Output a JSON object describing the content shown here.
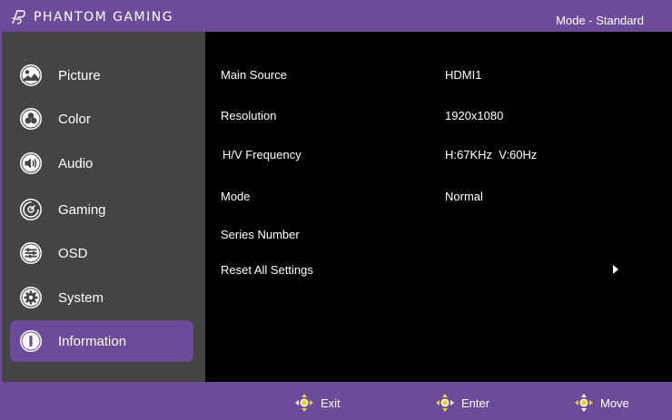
{
  "header": {
    "brand": "PHANTOM GAMING",
    "mode": "Mode - Standard"
  },
  "sidebar": {
    "items": [
      {
        "label": "Picture",
        "icon": "picture-icon",
        "active": false
      },
      {
        "label": "Color",
        "icon": "color-icon",
        "active": false
      },
      {
        "label": "Audio",
        "icon": "audio-icon",
        "active": false
      },
      {
        "label": "Gaming",
        "icon": "gaming-icon",
        "active": false
      },
      {
        "label": "OSD",
        "icon": "osd-icon",
        "active": false
      },
      {
        "label": "System",
        "icon": "system-icon",
        "active": false
      },
      {
        "label": "Information",
        "icon": "information-icon",
        "active": true
      }
    ]
  },
  "info": {
    "rows": [
      {
        "label": "Main Source",
        "value": "HDMI1"
      },
      {
        "label": "Resolution",
        "value": "1920x1080"
      },
      {
        "label": "H/V Frequency",
        "value": "H:67KHz  V:60Hz"
      },
      {
        "label": "Mode",
        "value": "Normal"
      },
      {
        "label": "Series Number",
        "value": ""
      },
      {
        "label": "Reset All Settings",
        "value": ""
      }
    ]
  },
  "footer": {
    "hints": [
      {
        "label": "Exit",
        "icon": "joystick-left-icon"
      },
      {
        "label": "Enter",
        "icon": "joystick-right-icon"
      },
      {
        "label": "Move",
        "icon": "joystick-updown-icon"
      }
    ]
  },
  "colors": {
    "accent": "#6c4b9b",
    "sidebar": "#444444",
    "background": "#000000",
    "joystick": "#f2d21b"
  }
}
